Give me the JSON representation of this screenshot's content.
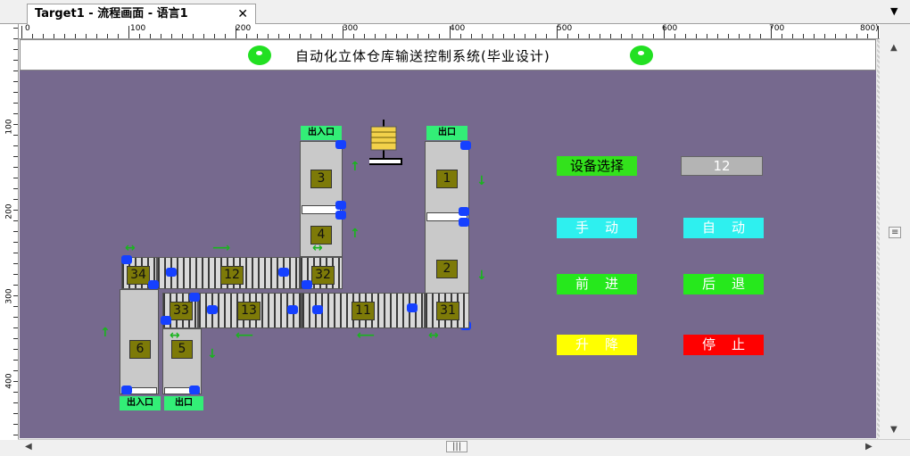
{
  "tab": {
    "title": "Target1 - 流程画面 - 语言1",
    "close": "✕"
  },
  "ruler": {
    "h_labels": [
      "0",
      "100",
      "200",
      "300",
      "400",
      "500",
      "600",
      "700",
      "800)"
    ],
    "v_labels": [
      "100",
      "200",
      "300",
      "400"
    ]
  },
  "header": {
    "title": "自动化立体仓库输送控制系统(毕业设计)"
  },
  "stations": {
    "s1": "1",
    "s2": "2",
    "s3": "3",
    "s4": "4",
    "s5": "5",
    "s6": "6",
    "s11": "11",
    "s12": "12",
    "s13": "13",
    "s31": "31",
    "s32": "32",
    "s33": "33",
    "s34": "34"
  },
  "ports": {
    "top_inout": "出入口",
    "top_out": "出口",
    "bottom_inout": "出入口",
    "bottom_out": "出口"
  },
  "controls": {
    "device_select_label": "设备选择",
    "device_value": "12",
    "manual": "手动",
    "auto": "自动",
    "forward": "前进",
    "backward": "后退",
    "lift": "升降",
    "stop": "停止"
  },
  "colors": {
    "canvas": "#76698e",
    "cyan": "#2ef0ef",
    "green": "#33e21c",
    "yellow": "#ffff00",
    "red": "#ff0000"
  }
}
